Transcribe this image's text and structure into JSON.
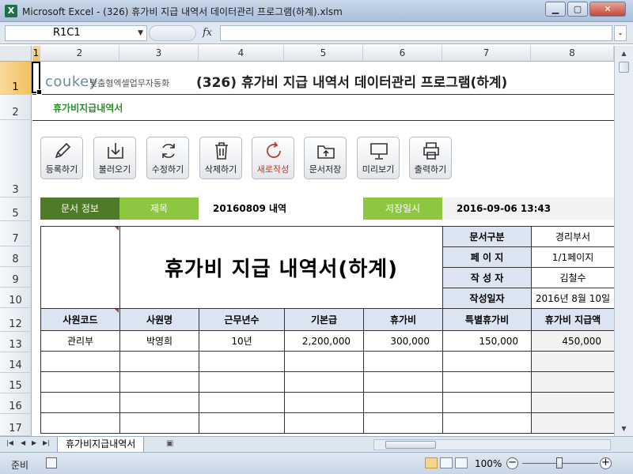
{
  "window": {
    "title": "Microsoft Excel - (326) 휴가비 지급 내역서 데이터관리 프로그램(하계).xlsm",
    "app_icon": "X"
  },
  "formula_bar": {
    "name_box": "R1C1",
    "fx_label": "fx",
    "formula": ""
  },
  "columns": [
    "1",
    "2",
    "3",
    "4",
    "5",
    "6",
    "7",
    "8"
  ],
  "rows": [
    "1",
    "2",
    "3",
    "5",
    "7",
    "8",
    "9",
    "10",
    "12",
    "13",
    "14",
    "15",
    "16",
    "17"
  ],
  "header": {
    "brand": "coukey",
    "brand_sub": "맞춤형엑셀업무자동화",
    "title": "(326) 휴가비 지급 내역서 데이터관리 프로그램(하계)",
    "subtitle": "휴가비지급내역서"
  },
  "toolbar": [
    {
      "label": "등록하기",
      "icon": "pencil-icon"
    },
    {
      "label": "불러오기",
      "icon": "import-icon"
    },
    {
      "label": "수정하기",
      "icon": "refresh-icon"
    },
    {
      "label": "삭제하기",
      "icon": "trash-icon"
    },
    {
      "label": "새로작성",
      "icon": "new-icon"
    },
    {
      "label": "문서저장",
      "icon": "folder-upload-icon"
    },
    {
      "label": "미리보기",
      "icon": "monitor-icon"
    },
    {
      "label": "출력하기",
      "icon": "printer-icon"
    }
  ],
  "doc_info": {
    "label": "문서 정보",
    "title_label": "제목",
    "title_value": "20160809 내역",
    "saved_label": "저장일시",
    "saved_value": "2016-09-06 13:43"
  },
  "document": {
    "big_title": "휴가비 지급 내역서(하계)",
    "meta": [
      {
        "label": "문서구분",
        "value": "경리부서"
      },
      {
        "label": "페 이 지",
        "value": "1/1페이지"
      },
      {
        "label": "작 성 자",
        "value": "김철수"
      },
      {
        "label": "작성일자",
        "value": "2016년 8월 10일"
      }
    ],
    "columns": [
      "사원코드",
      "사원명",
      "근무년수",
      "기본급",
      "휴가비",
      "특별휴가비",
      "휴가비 지급액"
    ],
    "rows": [
      [
        "관리부",
        "박영희",
        "10년",
        "2,200,000",
        "300,000",
        "150,000",
        "450,000"
      ]
    ]
  },
  "sheet_tab": "휴가비지급내역서",
  "status": {
    "ready": "준비",
    "zoom": "100%"
  },
  "colors": {
    "dark_green": "#4f7a28",
    "light_green": "#8dc63f",
    "header_blue": "#dbe5f1",
    "accent_red": "#c0392b"
  }
}
